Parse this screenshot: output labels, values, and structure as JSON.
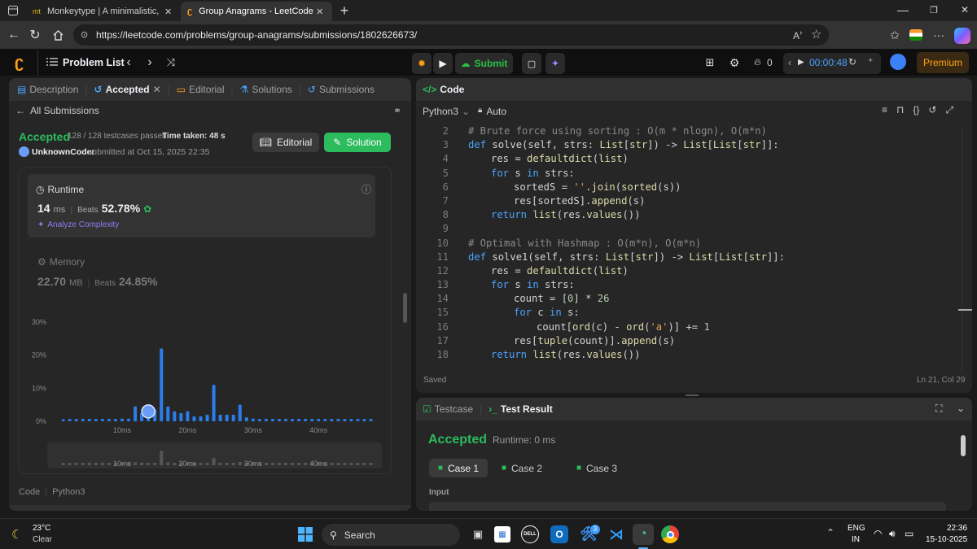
{
  "browser": {
    "tabs": [
      {
        "favicon": "mt",
        "title": "Monkeytype | A minimalistic, cust"
      },
      {
        "favicon": "leetcode-icon",
        "title": "Group Anagrams - LeetCode"
      }
    ],
    "url": "https://leetcode.com/problems/group-anagrams/submissions/1802626673/"
  },
  "nav": {
    "problem_list": "Problem List",
    "submit": "Submit",
    "streak": "0",
    "timer": "00:00:48",
    "premium": "Premium"
  },
  "left": {
    "tabs": [
      "Description",
      "Accepted",
      "Editorial",
      "Solutions",
      "Submissions"
    ],
    "all_submissions": "All Submissions",
    "status": "Accepted",
    "testcases": "128 / 128 testcases passed",
    "time_taken": "Time taken: 48 s",
    "user": "UnknownCoder",
    "submitted_at": "submitted at Oct 15, 2025 22:35",
    "editorial_btn": "Editorial",
    "solution_btn": "Solution",
    "runtime": {
      "label": "Runtime",
      "value": "14",
      "unit": "ms",
      "beats_label": "Beats",
      "beats": "52.78%",
      "analyze": "Analyze Complexity"
    },
    "memory": {
      "label": "Memory",
      "value": "22.70",
      "unit": "MB",
      "beats_label": "Beats",
      "beats": "24.85%"
    },
    "code_label": "Code",
    "code_lang": "Python3"
  },
  "chart_data": {
    "type": "bar",
    "ylabels": [
      "30%",
      "20%",
      "10%",
      "0%"
    ],
    "ylim": [
      0,
      30
    ],
    "xticks": [
      "10ms",
      "20ms",
      "30ms",
      "40ms"
    ],
    "x_first_ms": 1,
    "x_last_ms": 48,
    "values": [
      0.6,
      0.7,
      0.7,
      0.7,
      0.7,
      0.7,
      0.7,
      0.7,
      0.7,
      0.8,
      0.8,
      4.5,
      2.5,
      2.5,
      3.5,
      22,
      4.5,
      3,
      2.5,
      3,
      1.5,
      1.5,
      2,
      11,
      2,
      2,
      2,
      5,
      1.2,
      0.8,
      0.7,
      0.7,
      0.7,
      0.7,
      0.7,
      0.7,
      0.7,
      0.7,
      0.7,
      0.7,
      0.7,
      0.7,
      0.7,
      0.7,
      0.7,
      0.7,
      0.7,
      0.7
    ],
    "highlight_ms": 14,
    "accent": "#2b7de9"
  },
  "editor": {
    "title": "Code",
    "lang": "Python3",
    "mode": "Auto",
    "lines": [
      {
        "n": "2",
        "indent": 1,
        "code": "# Brute force using sorting : O(m * nlogn), O(m*n)"
      },
      {
        "n": "3",
        "indent": 1,
        "code": "def solve(self, strs: List[str]) -> List[List[str]]:"
      },
      {
        "n": "4",
        "indent": 2,
        "code": "res = defaultdict(list)"
      },
      {
        "n": "5",
        "indent": 2,
        "code": "for s in strs:"
      },
      {
        "n": "6",
        "indent": 3,
        "code": "sortedS = ''.join(sorted(s))"
      },
      {
        "n": "7",
        "indent": 3,
        "code": "res[sortedS].append(s)"
      },
      {
        "n": "8",
        "indent": 2,
        "code": "return list(res.values())"
      },
      {
        "n": "9",
        "indent": 0,
        "code": ""
      },
      {
        "n": "10",
        "indent": 1,
        "code": "# Optimal with Hashmap : O(m*n), O(m*n)"
      },
      {
        "n": "11",
        "indent": 1,
        "code": "def solve1(self, strs: List[str]) -> List[List[str]]:"
      },
      {
        "n": "12",
        "indent": 2,
        "code": "res = defaultdict(list)"
      },
      {
        "n": "13",
        "indent": 2,
        "code": "for s in strs:"
      },
      {
        "n": "14",
        "indent": 3,
        "code": "count = [0] * 26"
      },
      {
        "n": "15",
        "indent": 3,
        "code": "for c in s:"
      },
      {
        "n": "16",
        "indent": 4,
        "code": "count[ord(c) - ord('a')] += 1"
      },
      {
        "n": "17",
        "indent": 3,
        "code": "res[tuple(count)].append(s)"
      },
      {
        "n": "18",
        "indent": 2,
        "code": "return list(res.values())"
      }
    ],
    "saved": "Saved",
    "cursor": "Ln 21, Col 29"
  },
  "result": {
    "tab_testcase": "Testcase",
    "tab_result": "Test Result",
    "status": "Accepted",
    "runtime": "Runtime: 0 ms",
    "cases": [
      "Case 1",
      "Case 2",
      "Case 3"
    ],
    "input_label": "Input"
  },
  "taskbar": {
    "temp": "23°C",
    "weather": "Clear",
    "search": "Search",
    "lang1": "ENG",
    "lang2": "IN",
    "time": "22:36",
    "date": "15-10-2025",
    "badge": "3"
  }
}
